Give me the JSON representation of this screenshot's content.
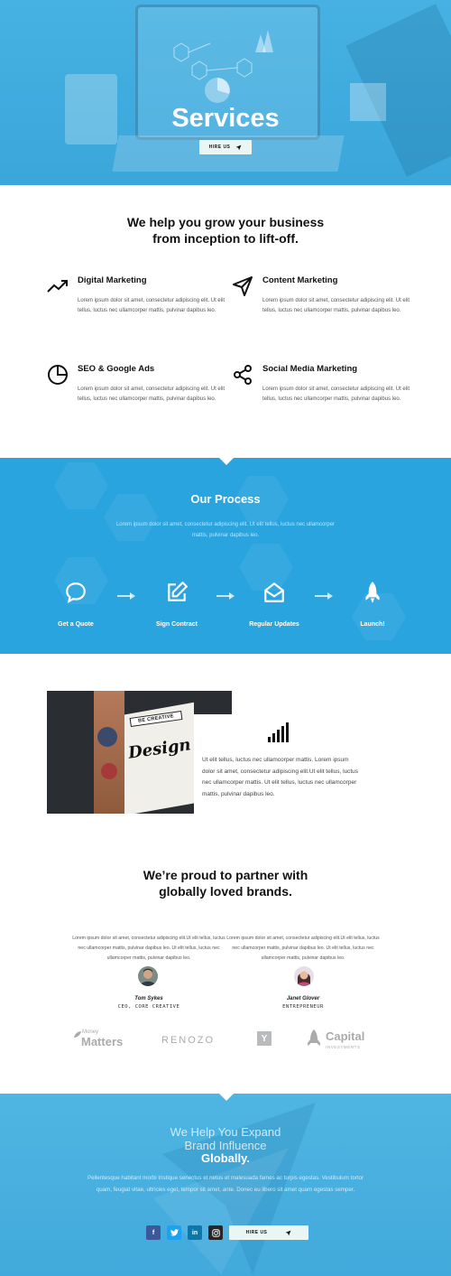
{
  "hero": {
    "title": "Services",
    "hire_label": "HIRE US"
  },
  "intro": {
    "title_line1": "We help you grow your business",
    "title_line2": "from inception to lift-off."
  },
  "services": [
    {
      "title": "Digital Marketing",
      "icon": "trending-up-icon",
      "text": "Lorem ipsum dolor sit amet, consectetur adipiscing elit. Ut elit tellus, luctus nec ullamcorper mattis, pulvinar dapibus leo."
    },
    {
      "title": "Content Marketing",
      "icon": "paper-plane-icon",
      "text": "Lorem ipsum dolor sit amet, consectetur adipiscing elit. Ut elit tellus, luctus nec ullamcorper mattis, pulvinar dapibus leo."
    },
    {
      "title": "SEO & Google Ads",
      "icon": "pie-chart-icon",
      "text": "Lorem ipsum dolor sit amet, consectetur adipiscing elit. Ut elit tellus, luctus nec ullamcorper mattis, pulvinar dapibus leo."
    },
    {
      "title": "Social Media Marketing",
      "icon": "share-icon",
      "text": "Lorem ipsum dolor sit amet, consectetur adipiscing elit. Ut elit tellus, luctus nec ullamcorper mattis, pulvinar dapibus leo."
    }
  ],
  "process": {
    "title": "Our Process",
    "subtitle": "Lorem ipsum dolor sit amet, consectetur adipiscing elit. Ut elit tellus, luctus nec ullamcorper mattis, pulvinar dapibus leo.",
    "steps": [
      {
        "label": "Get a Quote",
        "icon": "speech-bubble-icon"
      },
      {
        "label": "Sign Contract",
        "icon": "edit-icon"
      },
      {
        "label": "Regular Updates",
        "icon": "envelope-open-icon"
      },
      {
        "label": "Launch!",
        "icon": "rocket-icon"
      }
    ],
    "arrow_icon": "arrow-right-icon"
  },
  "design": {
    "image_banner": "BE CREATIVE",
    "image_word": "Design",
    "icon": "signal-bars-icon",
    "text": "Ut elit tellus, luctus nec ullamcorper mattis. Lorem ipsum dolor sit amet, consectetur adipiscing elit.Ut elit tellus, luctus nec ullamcorper mattis. Ut elit tellus, luctus nec ullamcorper mattis, pulvinar dapibus leo."
  },
  "partners": {
    "title_line1": "We’re proud to partner with",
    "title_line2": "globally loved brands.",
    "testimonials": [
      {
        "quote": "Lorem ipsum dolor sit amet, consectetur adipiscing elit.Ut elit tellus, luctus nec ullamcorper mattis, pulvinar dapibus leo. Ut elit tellus, luctus nec ullamcorper mattis, pulvinar dapibus leo.",
        "name": "Tom Sykes",
        "role": "CEO, CORE CREATIVE"
      },
      {
        "quote": "Lorem ipsum dolor sit amet, consectetur adipiscing elit.Ut elit tellus, luctus nec ullamcorper mattis, pulvinar dapibus leo. Ut elit tellus, luctus nec ullamcorper mattis, pulvinar dapibus leo.",
        "name": "Janet Glover",
        "role": "ENTREPRENEUR"
      }
    ],
    "logos": {
      "money_small": "Money",
      "money_big": "Matters",
      "renozo": "RENOZO",
      "y": "Y",
      "capital_big": "Capital",
      "capital_small": "INVESTMENTS"
    }
  },
  "cta": {
    "line1": "We Help You Expand",
    "line2": "Brand Influence",
    "line3": "Globally.",
    "text": "Pellentesque habitant morbi tristique senectus et netus et malesuada fames ac turpis egestas. Vestibulum tortor quam, feugiat vitae, ultricies eget, tempor sit amet, ante. Donec eu libero sit amet quam egestas semper.",
    "social": [
      {
        "label": "f",
        "icon": "facebook-icon",
        "color": "#3b5998"
      },
      {
        "label": "t",
        "icon": "twitter-icon",
        "color": "#1da1f2"
      },
      {
        "label": "in",
        "icon": "linkedin-icon",
        "color": "#0e76a8"
      },
      {
        "label": "ig",
        "icon": "instagram-icon",
        "color": "#262626"
      }
    ],
    "hire_label": "HIRE US"
  },
  "colors": {
    "accent": "#29a4df",
    "hero": "#46b1e2",
    "button_bg": "#eaf6f3"
  }
}
